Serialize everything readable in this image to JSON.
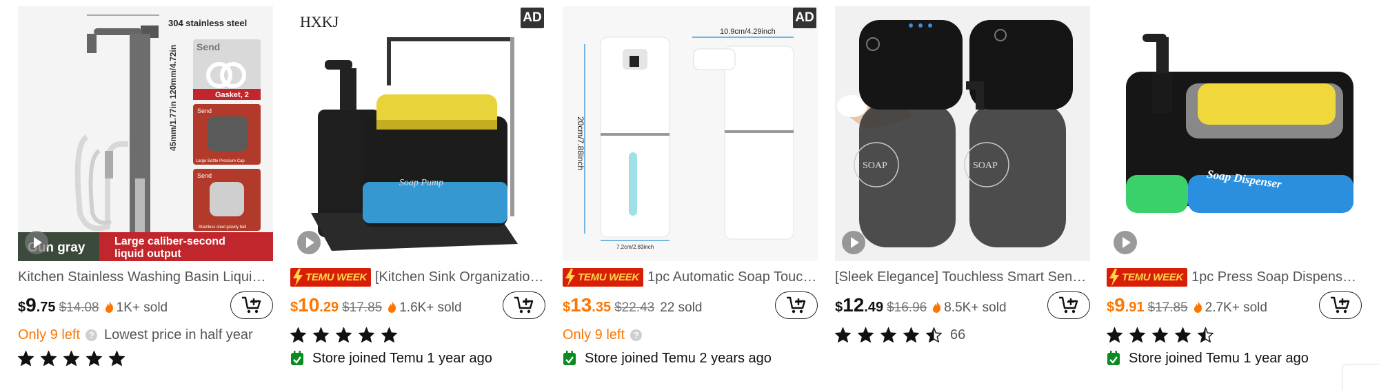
{
  "products": [
    {
      "title": "Kitchen Stainless Washing Basin Liquid ...",
      "price_currency": "$",
      "price_int": "9",
      "price_dec": ".75",
      "old_price": "$14.08",
      "sold": "1K+ sold",
      "left_warning": "Only 9 left",
      "lowest_note": "Lowest price in half year",
      "rating_stars": 5,
      "image_text": {
        "header": "304 stainless steel",
        "dims": "45mm/1.77in  120mm/4.72in",
        "send1": "Send",
        "gasket": "Gasket, 2",
        "send2": "Send",
        "cap": "Large Bottle Pressure Cap",
        "send3": "Send",
        "ball": "Stainless steel gravity ball",
        "banner_left": "Gun gray",
        "banner_right1": "Large caliber-second",
        "banner_right2": "liquid output"
      }
    },
    {
      "title": "[Kitchen Sink Organization S...",
      "badge": "TEMU WEEK",
      "price_currency": "$",
      "price_int": "10",
      "price_dec": ".29",
      "old_price": "$17.85",
      "sold": "1.6K+ sold",
      "rating_stars": 5,
      "store": "Store joined Temu 1 year ago",
      "ad": "AD",
      "image_text": {
        "brand": "HXKJ",
        "pump_label": "Soap Pump"
      }
    },
    {
      "title": "1pc Automatic Soap Touchle...",
      "badge": "TEMU WEEK",
      "price_currency": "$",
      "price_int": "13",
      "price_dec": ".35",
      "old_price": "$22.43",
      "sold": "22 sold",
      "left_warning": "Only 9 left",
      "store": "Store joined Temu 2 years ago",
      "ad": "AD",
      "image_text": {
        "width": "10.9cm/4.29inch",
        "height": "20cm/7.88inch",
        "base": "7.2cm/2.83inch"
      }
    },
    {
      "title": "[Sleek Elegance] Touchless Smart Sens...",
      "price_currency": "$",
      "price_int": "12",
      "price_dec": ".49",
      "old_price": "$16.96",
      "sold": "8.5K+ sold",
      "rating_stars": 4.5,
      "rating_count": "66",
      "image_text": {
        "label1": "SOAP",
        "label2": "SOAP"
      }
    },
    {
      "title": "1pc Press Soap Dispenser Ki...",
      "badge": "TEMU WEEK",
      "price_currency": "$",
      "price_int": "9",
      "price_dec": ".91",
      "old_price": "$17.85",
      "sold": "2.7K+ sold",
      "rating_stars": 4.5,
      "store": "Store joined Temu 1 year ago",
      "image_text": {
        "label": "Soap Dispenser"
      }
    }
  ],
  "colors": {
    "accent": "#fb7701",
    "temu_red": "#d81e06",
    "temu_yellow": "#ffd84a",
    "store_green": "#0a8a1f"
  },
  "icons": {
    "cart": "add-to-cart-icon",
    "flame": "flame-icon",
    "star": "star-icon",
    "play": "play-icon",
    "store": "store-calendar-icon"
  }
}
